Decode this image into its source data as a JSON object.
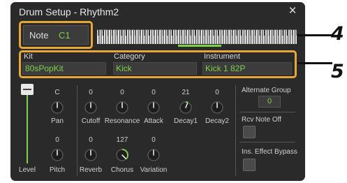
{
  "dialog": {
    "title": "Drum Setup - Rhythm2",
    "close_glyph": "×",
    "close_icon": "close-icon"
  },
  "note": {
    "label": "Note",
    "value": "C1"
  },
  "selectors": {
    "kit": {
      "label": "Kit",
      "value": "80sPopKit"
    },
    "category": {
      "label": "Category",
      "value": "Kick"
    },
    "instrument": {
      "label": "Instrument",
      "value": "Kick 1 82P"
    }
  },
  "callouts": {
    "one": "4",
    "two": "5"
  },
  "level": {
    "label": "Level",
    "value": "127",
    "fraction": 1.0
  },
  "knobs_left": [
    {
      "label": "Pan",
      "value": "C",
      "fraction": 0.5
    },
    {
      "label": "Pitch",
      "value": "0",
      "fraction": 0.5
    }
  ],
  "knobs_row1": [
    {
      "label": "Cutoff",
      "value": "0",
      "fraction": 0.5
    },
    {
      "label": "Resonance",
      "value": "0",
      "fraction": 0.5
    },
    {
      "label": "Attack",
      "value": "0",
      "fraction": 0.5
    },
    {
      "label": "Decay1",
      "value": "21",
      "fraction": 0.58
    },
    {
      "label": "Decay2",
      "value": "0",
      "fraction": 0.5
    }
  ],
  "knobs_row2": [
    {
      "label": "Reverb",
      "value": "0",
      "fraction": 0.5
    },
    {
      "label": "Chorus",
      "value": "127",
      "fraction": 1.0
    },
    {
      "label": "Variation",
      "value": "0",
      "fraction": 0.5
    }
  ],
  "right_panel": {
    "alternate_group_label": "Alternate Group",
    "alternate_group_value": "0",
    "rcv_note_off_label": "Rcv Note Off",
    "rcv_note_off_checked": false,
    "ins_effect_bypass_label": "Ins. Effect Bypass",
    "ins_effect_bypass_checked": false
  },
  "colors": {
    "accent": "#7fd14a",
    "highlight": "#e8a53a",
    "panel": "#2a2a2a"
  }
}
